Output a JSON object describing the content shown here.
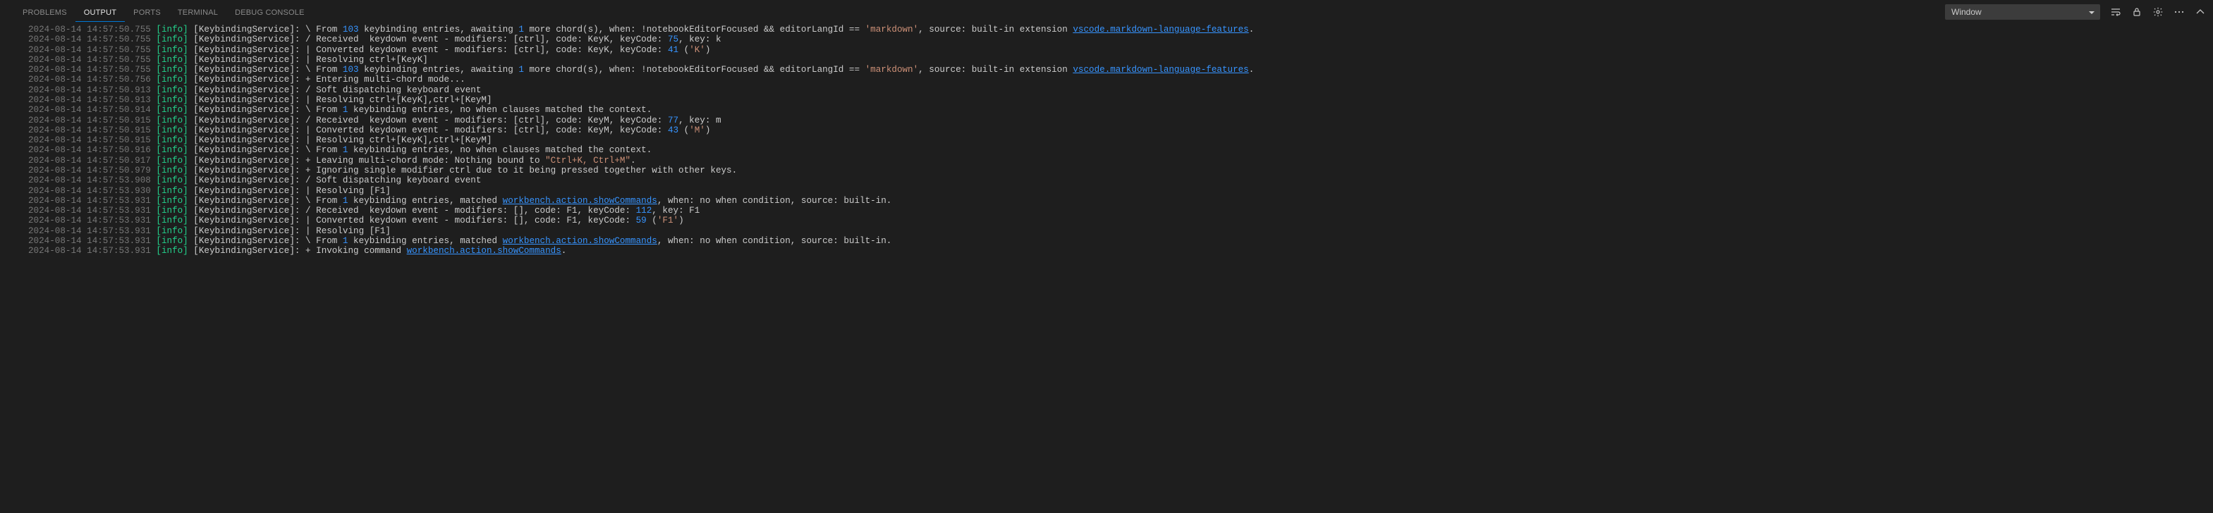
{
  "tabs": {
    "problems": "PROBLEMS",
    "output": "OUTPUT",
    "ports": "PORTS",
    "terminal": "TERMINAL",
    "debug_console": "DEBUG CONSOLE"
  },
  "channel_selected": "Window",
  "log": {
    "service": "[KeybindingService]:",
    "lines": [
      {
        "ts": "2024-08-14 14:57:50.755",
        "level": "[info]",
        "prefix": "\\ From ",
        "n1": "103",
        "mid": " keybinding entries, awaiting ",
        "n2": "1",
        "tail_a": " more chord(s), when: !notebookEditorFocused && editorLangId == ",
        "str": "'markdown'",
        "tail_b": ", source: built-in extension ",
        "ext": "vscode.markdown-language-features",
        "dot": "."
      },
      {
        "ts": "2024-08-14 14:57:50.755",
        "level": "[info]",
        "prefix": "/ Received  keydown event - modifiers: [ctrl], code: KeyK, keyCode: ",
        "n1": "75",
        "tail_a": ", key: k"
      },
      {
        "ts": "2024-08-14 14:57:50.755",
        "level": "[info]",
        "prefix": "| Converted keydown event - modifiers: [ctrl], code: KeyK, keyCode: ",
        "n1": "41",
        "tail_a": " (",
        "str": "'K'",
        "tail_b": ")"
      },
      {
        "ts": "2024-08-14 14:57:50.755",
        "level": "[info]",
        "prefix": "| Resolving ctrl+[KeyK]"
      },
      {
        "ts": "2024-08-14 14:57:50.755",
        "level": "[info]",
        "prefix": "\\ From ",
        "n1": "103",
        "mid": " keybinding entries, awaiting ",
        "n2": "1",
        "tail_a": " more chord(s), when: !notebookEditorFocused && editorLangId == ",
        "str": "'markdown'",
        "tail_b": ", source: built-in extension ",
        "ext": "vscode.markdown-language-features",
        "dot": "."
      },
      {
        "ts": "2024-08-14 14:57:50.756",
        "level": "[info]",
        "prefix": "+ Entering multi-chord mode..."
      },
      {
        "ts": "2024-08-14 14:57:50.913",
        "level": "[info]",
        "prefix": "/ Soft dispatching keyboard event"
      },
      {
        "ts": "2024-08-14 14:57:50.913",
        "level": "[info]",
        "prefix": "| Resolving ctrl+[KeyK],ctrl+[KeyM]"
      },
      {
        "ts": "2024-08-14 14:57:50.914",
        "level": "[info]",
        "prefix": "\\ From ",
        "n1": "1",
        "tail_a": " keybinding entries, no when clauses matched the context."
      },
      {
        "ts": "2024-08-14 14:57:50.915",
        "level": "[info]",
        "prefix": "/ Received  keydown event - modifiers: [ctrl], code: KeyM, keyCode: ",
        "n1": "77",
        "tail_a": ", key: m"
      },
      {
        "ts": "2024-08-14 14:57:50.915",
        "level": "[info]",
        "prefix": "| Converted keydown event - modifiers: [ctrl], code: KeyM, keyCode: ",
        "n1": "43",
        "tail_a": " (",
        "str": "'M'",
        "tail_b": ")"
      },
      {
        "ts": "2024-08-14 14:57:50.915",
        "level": "[info]",
        "prefix": "| Resolving ctrl+[KeyK],ctrl+[KeyM]"
      },
      {
        "ts": "2024-08-14 14:57:50.916",
        "level": "[info]",
        "prefix": "\\ From ",
        "n1": "1",
        "tail_a": " keybinding entries, no when clauses matched the context."
      },
      {
        "ts": "2024-08-14 14:57:50.917",
        "level": "[info]",
        "prefix": "+ Leaving multi-chord mode: Nothing bound to ",
        "str": "\"Ctrl+K, Ctrl+M\"",
        "tail_b": "."
      },
      {
        "ts": "2024-08-14 14:57:50.979",
        "level": "[info]",
        "prefix": "+ Ignoring single modifier ctrl due to it being pressed together with other keys."
      },
      {
        "ts": "2024-08-14 14:57:53.908",
        "level": "[info]",
        "prefix": "/ Soft dispatching keyboard event"
      },
      {
        "ts": "2024-08-14 14:57:53.930",
        "level": "[info]",
        "prefix": "| Resolving [F1]"
      },
      {
        "ts": "2024-08-14 14:57:53.931",
        "level": "[info]",
        "prefix": "\\ From ",
        "n1": "1",
        "tail_a": " keybinding entries, matched ",
        "cmd": "workbench.action.showCommands",
        "tail_b": ", when: no when condition, source: built-in."
      },
      {
        "ts": "2024-08-14 14:57:53.931",
        "level": "[info]",
        "prefix": "/ Received  keydown event - modifiers: [], code: F1, keyCode: ",
        "n1": "112",
        "tail_a": ", key: F1"
      },
      {
        "ts": "2024-08-14 14:57:53.931",
        "level": "[info]",
        "prefix": "| Converted keydown event - modifiers: [], code: F1, keyCode: ",
        "n1": "59",
        "tail_a": " (",
        "str": "'F1'",
        "tail_b": ")"
      },
      {
        "ts": "2024-08-14 14:57:53.931",
        "level": "[info]",
        "prefix": "| Resolving [F1]"
      },
      {
        "ts": "2024-08-14 14:57:53.931",
        "level": "[info]",
        "prefix": "\\ From ",
        "n1": "1",
        "tail_a": " keybinding entries, matched ",
        "cmd": "workbench.action.showCommands",
        "tail_b": ", when: no when condition, source: built-in."
      },
      {
        "ts": "2024-08-14 14:57:53.931",
        "level": "[info]",
        "prefix": "+ Invoking command ",
        "cmd": "workbench.action.showCommands",
        "tail_b": "."
      }
    ]
  }
}
